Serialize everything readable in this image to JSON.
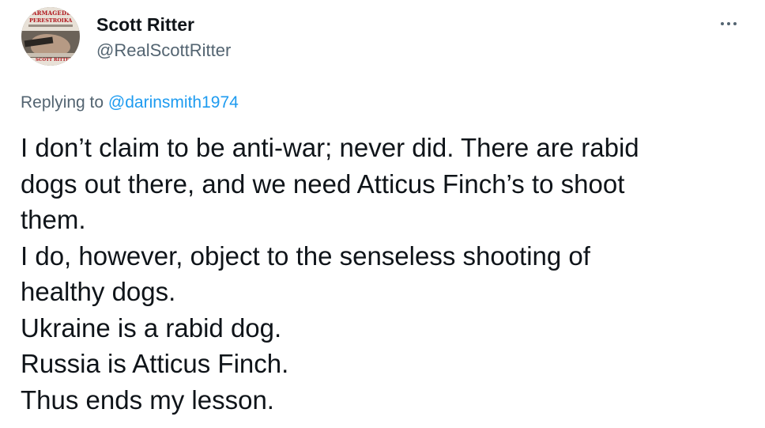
{
  "author": {
    "display_name": "Scott Ritter",
    "handle": "@RealScottRitter",
    "avatar_text_top": "ARMAGEDDON",
    "avatar_text_middle": "PERESTROIKA",
    "avatar_text_bottom": "SCOTT RITTER"
  },
  "reply": {
    "prefix": "Replying to ",
    "mention": "@darinsmith1974"
  },
  "tweet": {
    "lines": [
      "I don’t claim to be anti-war; never did. There are rabid",
      "dogs out there, and we need Atticus Finch’s to shoot",
      "them.",
      "I do, however, object to the senseless shooting of",
      "healthy dogs.",
      "Ukraine is a rabid dog.",
      "Russia is Atticus Finch.",
      "Thus ends my lesson."
    ]
  },
  "icons": {
    "more": "more-horizontal-icon"
  },
  "colors": {
    "text": "#0f1419",
    "secondary": "#536471",
    "link": "#1d9bf0",
    "background": "#ffffff"
  }
}
